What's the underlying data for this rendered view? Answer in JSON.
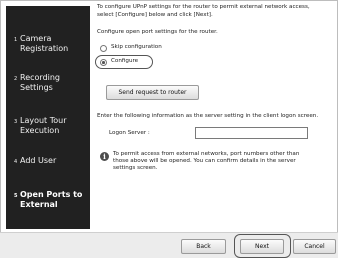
{
  "sidebar": {
    "steps": [
      {
        "num": "1",
        "label_line1": "Camera",
        "label_line2": "Registration"
      },
      {
        "num": "2",
        "label_line1": "Recording",
        "label_line2": "Settings"
      },
      {
        "num": "3",
        "label_line1": "Layout Tour",
        "label_line2": "Execution"
      },
      {
        "num": "4",
        "label_line1": "Add User",
        "label_line2": ""
      },
      {
        "num": "5",
        "label_line1": "Open Ports to",
        "label_line2": "External"
      }
    ],
    "active_step": 5
  },
  "main": {
    "intro_line1": "To configure UPnP settings for the router to permit external network access,",
    "intro_line2": "select [Configure] below and click [Next].",
    "configure_prompt": "Configure open port settings for the router.",
    "options": [
      {
        "label": "Skip configuration",
        "selected": false
      },
      {
        "label": "Configure",
        "selected": true
      }
    ],
    "send_button": "Send request to router",
    "logon_instruction": "Enter the following information as the server setting in the client logon screen.",
    "logon_label": "Logon Server :",
    "logon_value": "",
    "info_icon": "info-icon",
    "info_line1": "To permit access from external networks, port numbers other than",
    "info_line2": "those above will be opened. You can confirm details in the server",
    "info_line3": "settings screen."
  },
  "footer": {
    "back": "Back",
    "next": "Next",
    "cancel": "Cancel"
  }
}
